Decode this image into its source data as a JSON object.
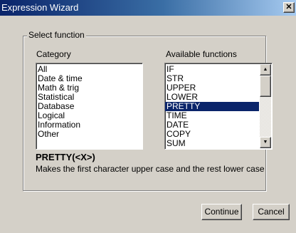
{
  "window": {
    "title": "Expression Wizard",
    "close_glyph": "✕"
  },
  "group": {
    "legend": "Select function"
  },
  "category": {
    "label": "Category",
    "items": [
      "All",
      "Date & time",
      "Math & trig",
      "Statistical",
      "Database",
      "Logical",
      "Information",
      "Other"
    ]
  },
  "functions": {
    "label": "Available functions",
    "items": [
      "IF",
      "STR",
      "UPPER",
      "LOWER",
      "PRETTY",
      "TIME",
      "DATE",
      "COPY",
      "SUM"
    ],
    "selected": "PRETTY"
  },
  "detail": {
    "signature": "PRETTY(<X>)",
    "description": "Makes the first character upper case and the rest lower case"
  },
  "buttons": {
    "continue": "Continue",
    "cancel": "Cancel"
  },
  "colors": {
    "selection": "#0a246a",
    "titlebar_start": "#0a246a",
    "face": "#d4d0c8"
  }
}
